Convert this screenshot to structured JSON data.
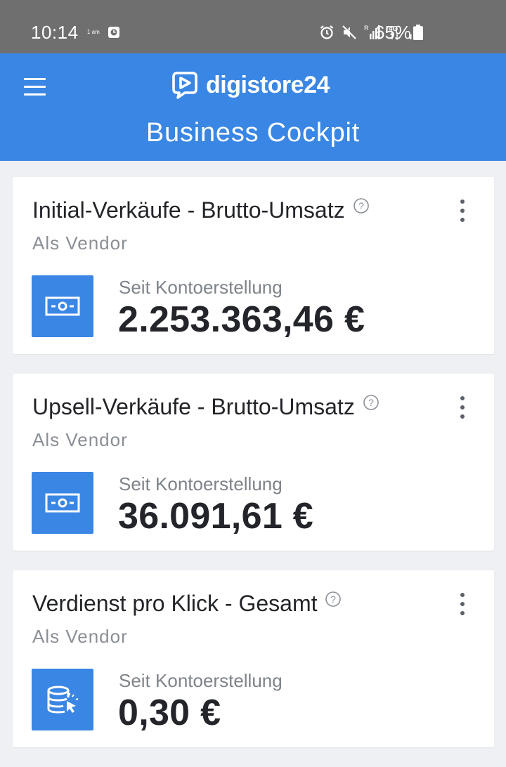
{
  "status_bar": {
    "time": "10:14",
    "ampm": "1 am",
    "battery_text": "65%"
  },
  "header": {
    "brand": "digistore24",
    "title": "Business Cockpit"
  },
  "cards": [
    {
      "title": "Initial-Verkäufe - Brutto-Umsatz",
      "subtitle": "Als Vendor",
      "label": "Seit Kontoerstellung",
      "value": "2.253.363,46 €",
      "icon": "cash-icon"
    },
    {
      "title": "Upsell-Verkäufe - Brutto-Umsatz",
      "subtitle": "Als Vendor",
      "label": "Seit Kontoerstellung",
      "value": "36.091,61 €",
      "icon": "cash-icon"
    },
    {
      "title": "Verdienst pro Klick - Gesamt",
      "subtitle": "Als Vendor",
      "label": "Seit Kontoerstellung",
      "value": "0,30 €",
      "icon": "database-click-icon"
    }
  ],
  "colors": {
    "brand_blue": "#3a86e4",
    "status_bar": "#6f6f6f",
    "background": "#eef0f3"
  }
}
